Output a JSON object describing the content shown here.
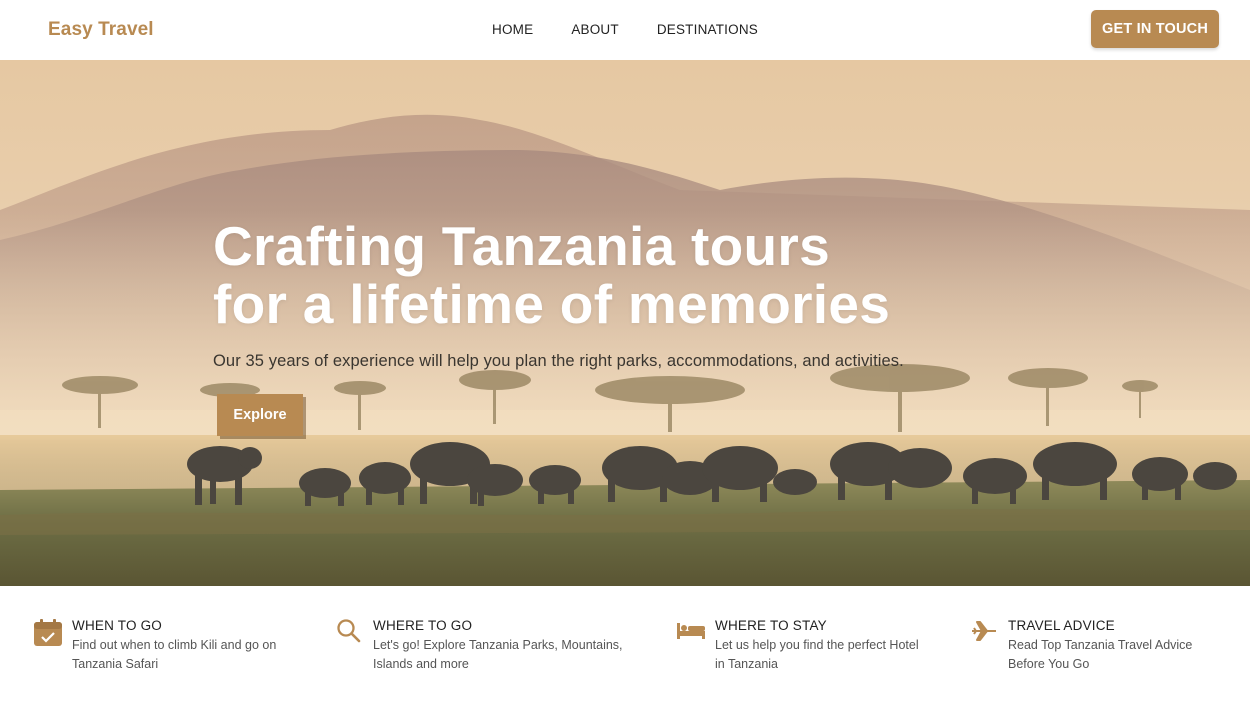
{
  "header": {
    "brand": "Easy Travel",
    "nav": [
      "HOME",
      "ABOUT",
      "DESTINATIONS"
    ],
    "cta_label": "GET IN TOUCH"
  },
  "hero": {
    "title_line1": "Crafting Tanzania tours",
    "title_line2": "for a lifetime of memories",
    "subtitle": "Our 35 years of experience will help you plan the right parks, accommodations, and activities.",
    "button_label": "Explore"
  },
  "features": [
    {
      "icon": "calendar-check-icon",
      "title": "WHEN TO GO",
      "line1": "Find out when to climb Kili and go on",
      "line2": "Tanzania Safari"
    },
    {
      "icon": "search-icon",
      "title": "WHERE TO GO",
      "line1": "Let's go! Explore Tanzania Parks, Mountains,",
      "line2": "Islands and more"
    },
    {
      "icon": "bed-icon",
      "title": "WHERE TO STAY",
      "line1": "Let us help you find the perfect Hotel",
      "line2": "in Tanzania"
    },
    {
      "icon": "plane-icon",
      "title": "TRAVEL ADVICE",
      "line1": "Read Top Tanzania Travel Advice",
      "line2": "Before You Go"
    }
  ],
  "colors": {
    "accent": "#b88a52",
    "text": "#222222"
  }
}
